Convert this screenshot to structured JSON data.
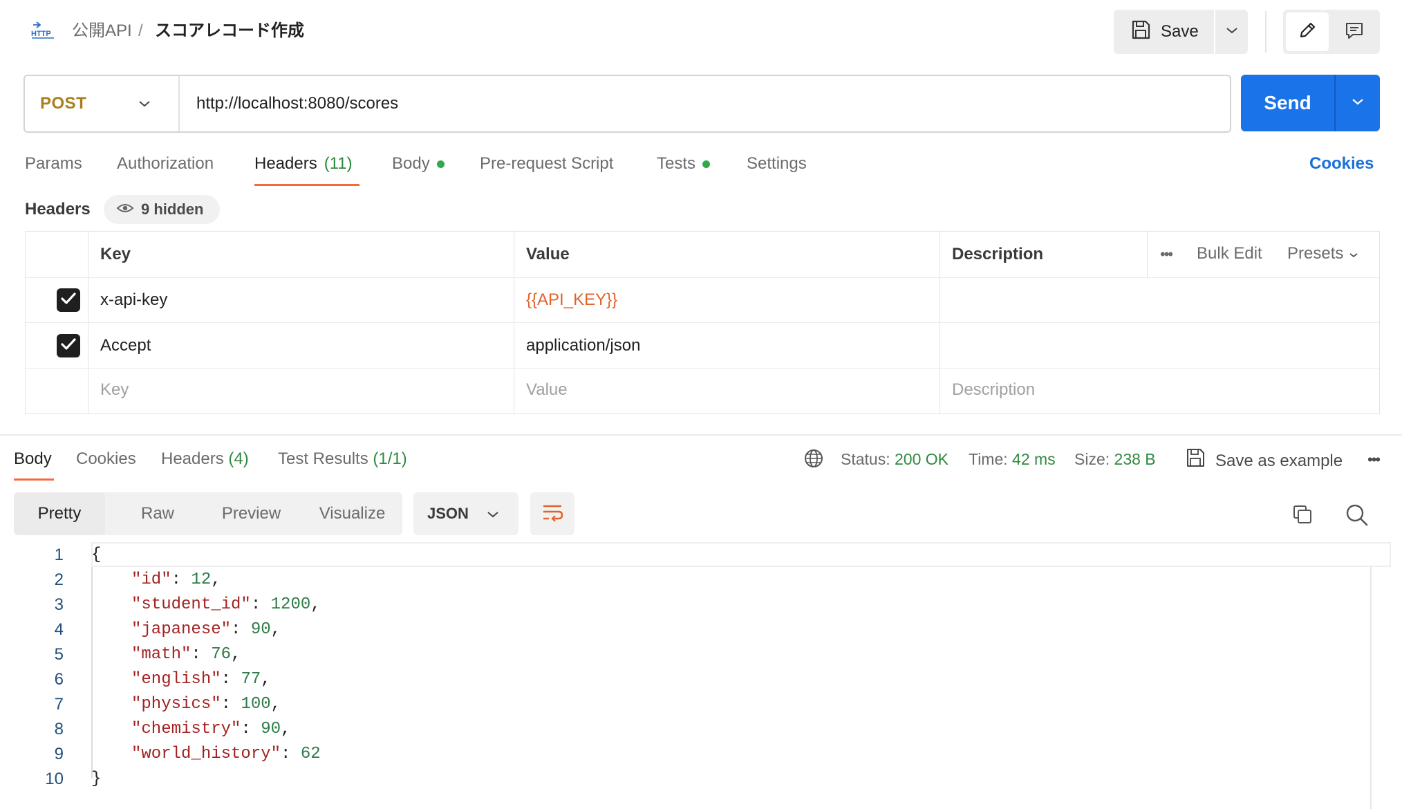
{
  "breadcrumb": {
    "icon": "http-icon",
    "parent": "公開API",
    "separator": "/",
    "current": "スコアレコード作成"
  },
  "toolbar": {
    "save_label": "Save"
  },
  "request": {
    "method": "POST",
    "url": "http://localhost:8080/scores",
    "send_label": "Send"
  },
  "request_tabs": [
    {
      "label": "Params"
    },
    {
      "label": "Authorization"
    },
    {
      "label": "Headers",
      "count": "(11)",
      "active": true
    },
    {
      "label": "Body",
      "dot": true
    },
    {
      "label": "Pre-request Script"
    },
    {
      "label": "Tests",
      "dot": true
    },
    {
      "label": "Settings"
    }
  ],
  "cookies_link": "Cookies",
  "headers_section": {
    "title": "Headers",
    "hidden_label": "9 hidden",
    "columns": {
      "key": "Key",
      "value": "Value",
      "description": "Description"
    },
    "actions": {
      "bulk_edit": "Bulk Edit",
      "presets": "Presets",
      "more": "•••"
    },
    "rows": [
      {
        "checked": true,
        "key": "x-api-key",
        "value": "{{API_KEY}}",
        "value_is_variable": true,
        "description": ""
      },
      {
        "checked": true,
        "key": "Accept",
        "value": "application/json",
        "description": ""
      }
    ],
    "placeholders": {
      "key": "Key",
      "value": "Value",
      "description": "Description"
    }
  },
  "response": {
    "tabs": [
      {
        "label": "Body",
        "active": true
      },
      {
        "label": "Cookies"
      },
      {
        "label": "Headers",
        "count": "(4)"
      },
      {
        "label": "Test Results",
        "count": "(1/1)"
      }
    ],
    "status_label": "Status:",
    "status_value": "200 OK",
    "time_label": "Time:",
    "time_value": "42 ms",
    "size_label": "Size:",
    "size_value": "238 B",
    "save_example": "Save as example",
    "more": "•••",
    "view_modes": [
      "Pretty",
      "Raw",
      "Preview",
      "Visualize"
    ],
    "active_view": "Pretty",
    "format": "JSON",
    "body_lines": [
      {
        "n": "1",
        "text": "{"
      },
      {
        "n": "2",
        "key": "\"id\"",
        "value": "12",
        "comma": true
      },
      {
        "n": "3",
        "key": "\"student_id\"",
        "value": "1200",
        "comma": true
      },
      {
        "n": "4",
        "key": "\"japanese\"",
        "value": "90",
        "comma": true
      },
      {
        "n": "5",
        "key": "\"math\"",
        "value": "76",
        "comma": true
      },
      {
        "n": "6",
        "key": "\"english\"",
        "value": "77",
        "comma": true
      },
      {
        "n": "7",
        "key": "\"physics\"",
        "value": "100",
        "comma": true
      },
      {
        "n": "8",
        "key": "\"chemistry\"",
        "value": "90",
        "comma": true
      },
      {
        "n": "9",
        "key": "\"world_history\"",
        "value": "62",
        "comma": false
      },
      {
        "n": "10",
        "text": "}"
      }
    ]
  },
  "colors": {
    "accent": "#f26b3a",
    "primary": "#1a73e8",
    "success": "#2f8a3f",
    "method_post": "#a87f1d",
    "variable": "#e0632d",
    "json_key": "#a32121",
    "json_number": "#2d7a48"
  }
}
